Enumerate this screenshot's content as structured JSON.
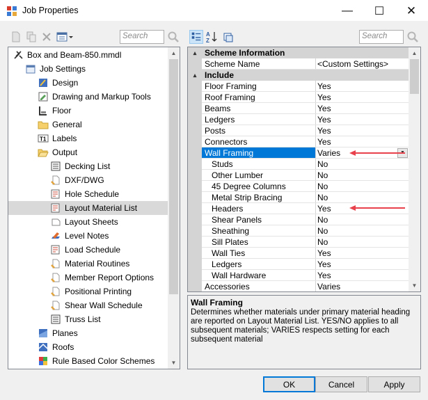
{
  "window": {
    "title": "Job Properties",
    "min_symbol": "—",
    "max_symbol": "☐",
    "close_symbol": "✕"
  },
  "left_search": {
    "placeholder": "Search"
  },
  "right_search": {
    "placeholder": "Search"
  },
  "tree": {
    "items": [
      {
        "label": "Box and Beam-850.mmdl",
        "icon": "tools-icon"
      },
      {
        "label": "Job Settings",
        "icon": "job-settings-icon"
      },
      {
        "label": "Design",
        "icon": "design-icon"
      },
      {
        "label": "Drawing and Markup Tools",
        "icon": "markup-tools-icon"
      },
      {
        "label": "Floor",
        "icon": "floor-icon"
      },
      {
        "label": "General",
        "icon": "folder-icon"
      },
      {
        "label": "Labels",
        "icon": "labels-icon"
      },
      {
        "label": "Output",
        "icon": "folder-open-icon"
      },
      {
        "label": "Decking List",
        "icon": "list-icon"
      },
      {
        "label": "DXF/DWG",
        "icon": "document-icon"
      },
      {
        "label": "Hole Schedule",
        "icon": "schedule-icon"
      },
      {
        "label": "Layout Material List",
        "icon": "schedule-icon"
      },
      {
        "label": "Layout Sheets",
        "icon": "sheets-icon"
      },
      {
        "label": "Level Notes",
        "icon": "notes-icon"
      },
      {
        "label": "Load Schedule",
        "icon": "schedule-icon"
      },
      {
        "label": "Material Routines",
        "icon": "document-icon"
      },
      {
        "label": "Member Report Options",
        "icon": "document-icon"
      },
      {
        "label": "Positional Printing",
        "icon": "document-icon"
      },
      {
        "label": "Shear Wall Schedule",
        "icon": "document-icon"
      },
      {
        "label": "Truss List",
        "icon": "list-icon"
      },
      {
        "label": "Planes",
        "icon": "planes-icon"
      },
      {
        "label": "Roofs",
        "icon": "roofs-icon"
      },
      {
        "label": "Rule Based Color Schemes",
        "icon": "color-schemes-icon"
      }
    ]
  },
  "grid": {
    "rows": [
      {
        "kind": "category",
        "name": "Scheme Information",
        "toggle": "▴"
      },
      {
        "kind": "prop",
        "name": "Scheme Name",
        "value": "<Custom Settings>",
        "indent": 0
      },
      {
        "kind": "category",
        "name": "Include",
        "toggle": "▴"
      },
      {
        "kind": "prop",
        "name": "Floor Framing",
        "value": "Yes",
        "indent": 0
      },
      {
        "kind": "prop",
        "name": "Roof Framing",
        "value": "Yes",
        "indent": 0
      },
      {
        "kind": "prop",
        "name": "Beams",
        "value": "Yes",
        "indent": 0
      },
      {
        "kind": "prop",
        "name": "Ledgers",
        "value": "Yes",
        "indent": 0
      },
      {
        "kind": "prop",
        "name": "Posts",
        "value": "Yes",
        "indent": 0
      },
      {
        "kind": "prop",
        "name": "Connectors",
        "value": "Yes",
        "indent": 0
      },
      {
        "kind": "prop",
        "name": "Wall Framing",
        "value": "Varies",
        "indent": 0,
        "selected": true
      },
      {
        "kind": "prop",
        "name": "Studs",
        "value": "No",
        "indent": 1
      },
      {
        "kind": "prop",
        "name": "Other Lumber",
        "value": "No",
        "indent": 1
      },
      {
        "kind": "prop",
        "name": "45 Degree Columns",
        "value": "No",
        "indent": 1
      },
      {
        "kind": "prop",
        "name": "Metal Strip Bracing",
        "value": "No",
        "indent": 1
      },
      {
        "kind": "prop",
        "name": "Headers",
        "value": "Yes",
        "indent": 1
      },
      {
        "kind": "prop",
        "name": "Shear Panels",
        "value": "No",
        "indent": 1
      },
      {
        "kind": "prop",
        "name": "Sheathing",
        "value": "No",
        "indent": 1
      },
      {
        "kind": "prop",
        "name": "Sill Plates",
        "value": "No",
        "indent": 1
      },
      {
        "kind": "prop",
        "name": "Wall Ties",
        "value": "Yes",
        "indent": 1
      },
      {
        "kind": "prop",
        "name": "Ledgers",
        "value": "Yes",
        "indent": 1
      },
      {
        "kind": "prop",
        "name": "Wall Hardware",
        "value": "Yes",
        "indent": 1
      },
      {
        "kind": "prop",
        "name": "Accessories",
        "value": "Varies",
        "indent": 0
      }
    ]
  },
  "description": {
    "title": "Wall Framing",
    "text": "Determines whether materials under primary material heading are reported on Layout Material List. YES/NO applies to all subsequent materials; VARIES respects setting for each subsequent material"
  },
  "buttons": {
    "ok": "OK",
    "cancel": "Cancel",
    "apply": "Apply"
  },
  "colors": {
    "selection": "#0078d7",
    "annotation_arrow": "#e8414b",
    "category_bg": "#d4d4d4"
  }
}
